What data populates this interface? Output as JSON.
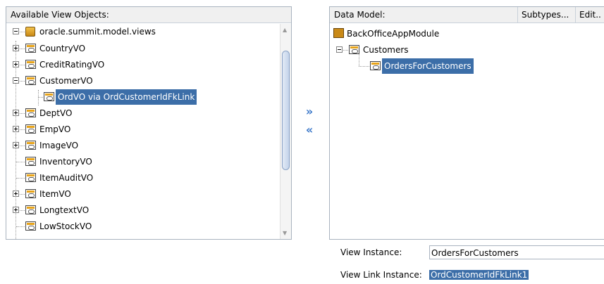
{
  "left_panel": {
    "header": "Available View Objects:",
    "root": "oracle.summit.model.views",
    "items": [
      {
        "label": "CountryVO",
        "expander": "plus"
      },
      {
        "label": "CreditRatingVO",
        "expander": "plus"
      },
      {
        "label": "CustomerVO",
        "expander": "minus"
      },
      {
        "label": "OrdVO via OrdCustomerIdFkLink",
        "child": true,
        "selected": true
      },
      {
        "label": "DeptVO",
        "expander": "plus"
      },
      {
        "label": "EmpVO",
        "expander": "plus"
      },
      {
        "label": "ImageVO",
        "expander": "plus"
      },
      {
        "label": "InventoryVO"
      },
      {
        "label": "ItemAuditVO"
      },
      {
        "label": "ItemVO",
        "expander": "plus"
      },
      {
        "label": "LongtextVO",
        "expander": "plus"
      },
      {
        "label": "LowStockVO"
      }
    ]
  },
  "shuttle": {
    "add_symbol": "»",
    "remove_symbol": "«"
  },
  "right_panel": {
    "header": "Data Model:",
    "subtypes_button": "Subtypes...",
    "edit_button": "Edit..",
    "app_module": "BackOfficeAppModule",
    "customers": "Customers",
    "orders": "OrdersForCustomers"
  },
  "fields": {
    "view_instance_label": "View Instance:",
    "view_instance_value": "OrdersForCustomers",
    "view_link_label": "View Link Instance:",
    "view_link_value": "OrdCustomerIdFkLink1"
  },
  "colors": {
    "selection": "#3c6ea8",
    "accent": "#3a77c9"
  }
}
